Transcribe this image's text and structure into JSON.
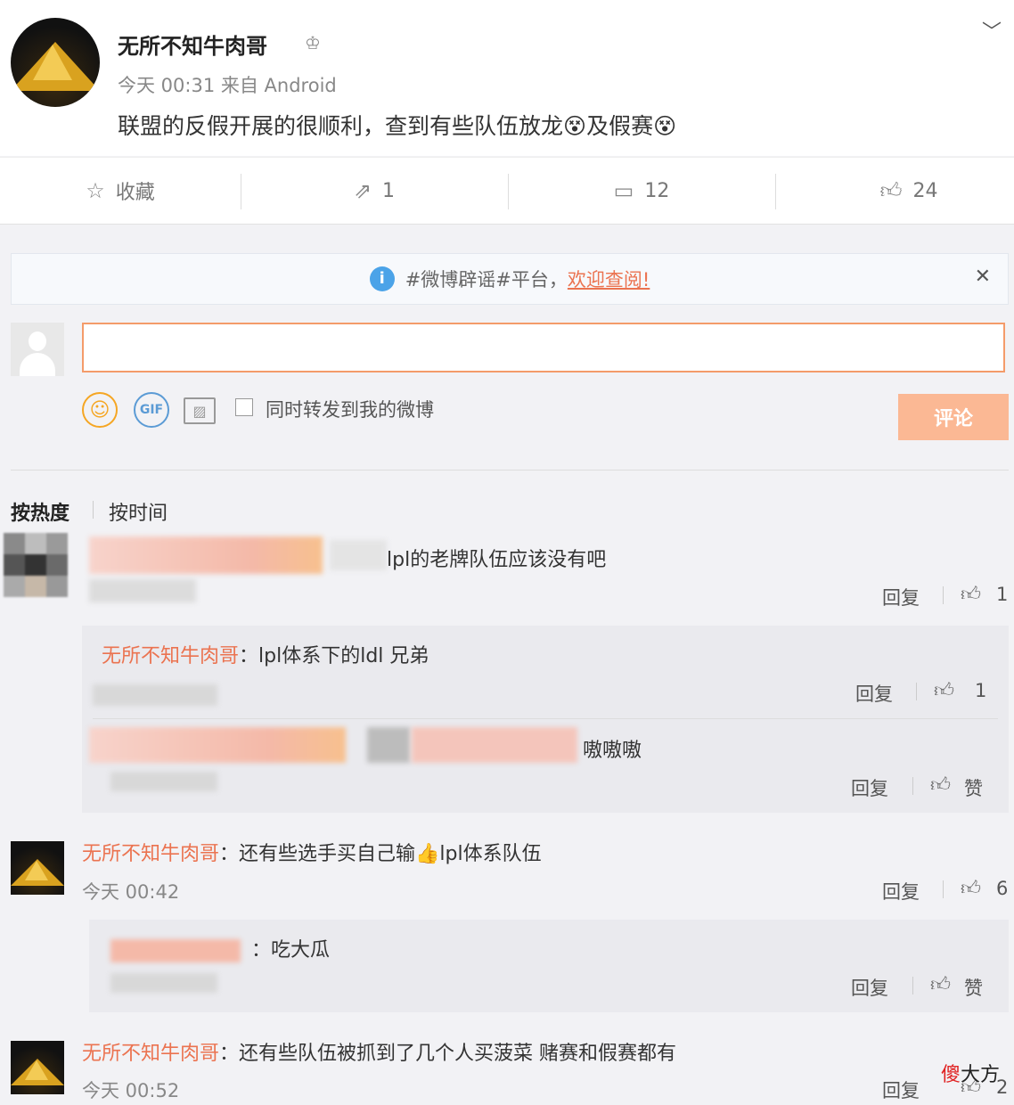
{
  "post": {
    "author": "无所不知牛肉哥",
    "meta": "今天 00:31 来自 Android",
    "text": "联盟的反假开展的很顺利，查到有些队伍放龙😵及假赛😵"
  },
  "actions": {
    "favorite_label": "收藏",
    "repost_count": "1",
    "comment_count": "12",
    "like_count": "24"
  },
  "notice": {
    "text": "#微博辟谣#平台，",
    "link": "欢迎查阅!"
  },
  "compose": {
    "repost_checkbox_label": "同时转发到我的微博",
    "submit_label": "评论"
  },
  "sort": {
    "hot": "按热度",
    "time": "按时间"
  },
  "comments": [
    {
      "text": "lpl的老牌队伍应该没有吧",
      "reply_label": "回复",
      "like_count": "1",
      "subreplies": [
        {
          "author": "无所不知牛肉哥",
          "text": "lpl体系下的ldl 兄弟",
          "reply_label": "回复",
          "like_count": "1"
        },
        {
          "text": "嗷嗷嗷",
          "reply_label": "回复",
          "like_label": "赞"
        }
      ]
    },
    {
      "author": "无所不知牛肉哥",
      "text": "还有些选手买自己输👍lpl体系队伍",
      "time": "今天 00:42",
      "reply_label": "回复",
      "like_count": "6",
      "subreplies": [
        {
          "text": "：吃大瓜",
          "reply_label": "回复",
          "like_label": "赞"
        }
      ]
    },
    {
      "author": "无所不知牛肉哥",
      "text": "还有些队伍被抓到了几个人买菠菜 赌赛和假赛都有",
      "time": "今天 00:52",
      "reply_label": "回复",
      "like_count": "2"
    }
  ],
  "watermark": {
    "char1": "傻",
    "rest": "大方"
  }
}
